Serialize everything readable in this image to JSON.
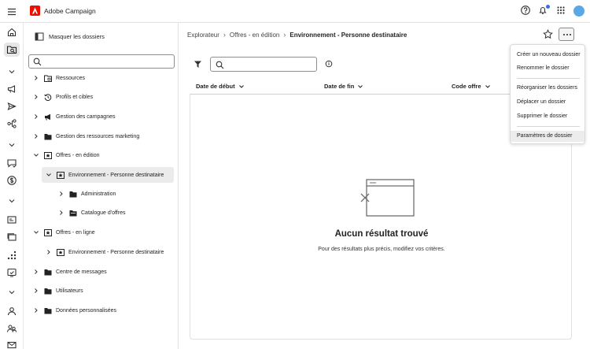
{
  "app": {
    "title": "Adobe Campaign"
  },
  "topbar": {
    "icons": [
      "menu-icon",
      "adobe-logo-icon",
      "help-icon",
      "bell-icon",
      "apps-grid-icon",
      "avatar"
    ]
  },
  "rail": {
    "icons": [
      "home-icon",
      "explorer-icon",
      "chevron-down-icon",
      "megaphone-icon",
      "send-icon",
      "workflow-icon",
      "chevron-down-icon",
      "message-icon",
      "dollar-icon",
      "chevron-down-icon",
      "id-card-icon",
      "layers-icon",
      "chart-icon",
      "monitor-icon",
      "chevron-down-icon",
      "user-icon",
      "users-icon",
      "mail-icon"
    ]
  },
  "panel": {
    "hide_label": "Masquer les dossiers",
    "search_placeholder": "",
    "tree": [
      {
        "label": "Ressources",
        "icon": "resource-folder-icon",
        "expanded": false
      },
      {
        "label": "Profils et cibles",
        "icon": "profile-icon",
        "expanded": false
      },
      {
        "label": "Gestion des campagnes",
        "icon": "megaphone-icon",
        "expanded": false
      },
      {
        "label": "Gestion des ressources marketing",
        "icon": "folder-icon",
        "expanded": false
      },
      {
        "label": "Offres - en édition",
        "icon": "offer-icon",
        "expanded": true
      },
      {
        "label": "Environnement - Personne destinataire",
        "icon": "offer-icon",
        "expanded": true,
        "selected": true
      },
      {
        "label": "Administration",
        "icon": "folder-icon",
        "expanded": false
      },
      {
        "label": "Catalogue d'offres",
        "icon": "folder-icon",
        "expanded": false
      },
      {
        "label": "Offres - en ligne",
        "icon": "offer-icon",
        "expanded": true
      },
      {
        "label": "Environnement - Personne destinataire",
        "icon": "offer-icon",
        "expanded": false
      },
      {
        "label": "Centre de messages",
        "icon": "folder-icon",
        "expanded": false
      },
      {
        "label": "Utilisateurs",
        "icon": "folder-icon",
        "expanded": false
      },
      {
        "label": "Données personnalisées",
        "icon": "folder-icon",
        "expanded": false
      }
    ]
  },
  "breadcrumb": {
    "items": [
      "Explorateur",
      "Offres - en édition",
      "Environnement - Personne destinataire"
    ]
  },
  "toolbar": {
    "search_placeholder": ""
  },
  "table": {
    "columns": [
      "Date de début",
      "Date de fin",
      "Code offre"
    ]
  },
  "empty": {
    "title": "Aucun résultat trouvé",
    "subtitle": "Pour des résultats plus précis, modifiez vos critères."
  },
  "menu": {
    "groups": [
      [
        "Créer un nouveau dossier",
        "Renommer le dossier"
      ],
      [
        "Réorganiser les dossiers",
        "Déplacer un dossier",
        "Supprimer le dossier"
      ],
      [
        "Paramètres de dossier"
      ]
    ],
    "highlighted": "Paramètres de dossier"
  },
  "colors": {
    "adobe_red": "#eb1000",
    "avatar": "#5aa9e6",
    "notification": "#3a6fd8"
  }
}
